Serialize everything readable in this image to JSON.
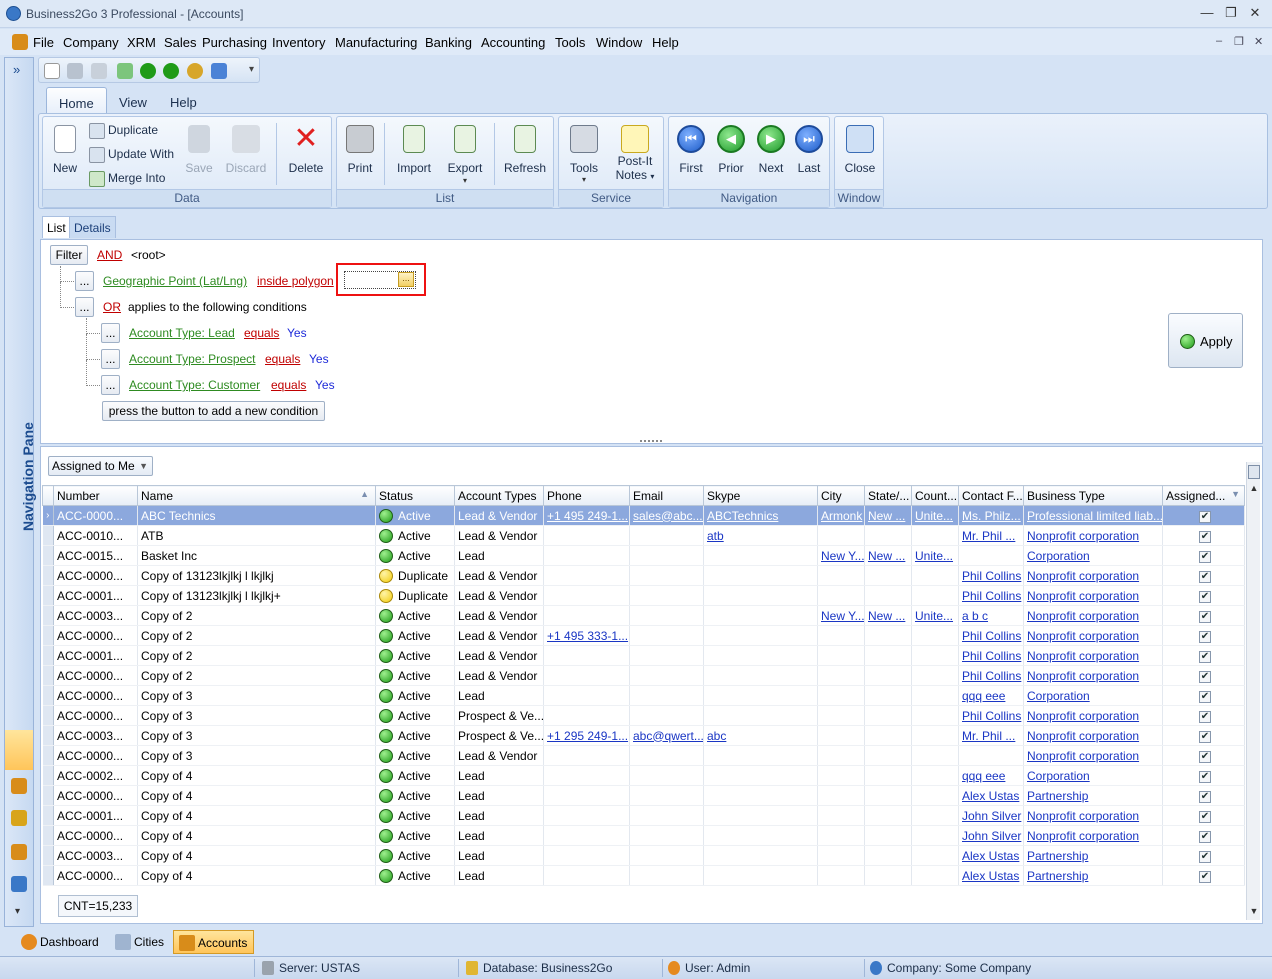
{
  "window": {
    "title": "Business2Go 3 Professional - [Accounts]"
  },
  "menu": [
    "File",
    "Company",
    "XRM",
    "Sales",
    "Purchasing",
    "Inventory",
    "Manufacturing",
    "Banking",
    "Accounting",
    "Tools",
    "Window",
    "Help"
  ],
  "ribbon": {
    "tabs": [
      "Home",
      "View",
      "Help"
    ],
    "groups": {
      "data": "Data",
      "list": "List",
      "service": "Service",
      "navigation": "Navigation",
      "window": "Window"
    },
    "buttons": {
      "new": "New",
      "duplicate": "Duplicate",
      "update_with": "Update With",
      "merge_into": "Merge Into",
      "save": "Save",
      "discard": "Discard",
      "delete": "Delete",
      "print": "Print",
      "import": "Import",
      "export": "Export",
      "refresh": "Refresh",
      "tools": "Tools",
      "postit1": "Post-It",
      "postit2": "Notes",
      "first": "First",
      "prior": "Prior",
      "next": "Next",
      "last": "Last",
      "close": "Close"
    }
  },
  "subtabs": [
    "List",
    "Details"
  ],
  "filter": {
    "filter_btn": "Filter",
    "root_op": "AND",
    "root_label": "<root>",
    "ellipsis": "...",
    "cond1_field": "Geographic Point (Lat/Lng)",
    "cond1_op": "inside polygon",
    "or_op": "OR",
    "or_text": "applies to the following conditions",
    "sub": [
      {
        "field": "Account Type: Lead",
        "op": "equals",
        "val": "Yes"
      },
      {
        "field": "Account Type: Prospect",
        "op": "equals",
        "val": "Yes"
      },
      {
        "field": "Account Type: Customer",
        "op": "equals",
        "val": "Yes"
      }
    ],
    "add_btn": "press the button to add a new condition",
    "apply": "Apply"
  },
  "grid": {
    "dropdown": "Assigned to Me",
    "columns": [
      "Number",
      "Name",
      "Status",
      "Account Types",
      "Phone",
      "Email",
      "Skype",
      "City",
      "State/...",
      "Count...",
      "Contact F...",
      "Business Type",
      "Assigned..."
    ],
    "rows": [
      [
        "ACC-0000...",
        "ABC Technics",
        "Active",
        "Lead & Vendor",
        "+1 495 249-1...",
        "sales@abc....",
        "ABCTechnics",
        "Armonk",
        "New ...",
        "Unite...",
        "Ms. Philz...",
        "Professional limited liab..."
      ],
      [
        "ACC-0010...",
        "ATB",
        "Active",
        "Lead & Vendor",
        "",
        "",
        "atb",
        "",
        "",
        "",
        "Mr. Phil ...",
        "Nonprofit corporation"
      ],
      [
        "ACC-0015...",
        "Basket Inc",
        "Active",
        "Lead",
        "",
        "",
        "",
        "New Y...",
        "New ...",
        "Unite...",
        "",
        "Corporation"
      ],
      [
        "ACC-0000...",
        "Copy of 13123lkjlkj l lkjlkj",
        "Duplicate",
        "Lead & Vendor",
        "",
        "",
        "",
        "",
        "",
        "",
        "Phil Collins",
        "Nonprofit corporation"
      ],
      [
        "ACC-0001...",
        "Copy of 13123lkjlkj l lkjlkj+",
        "Duplicate",
        "Lead & Vendor",
        "",
        "",
        "",
        "",
        "",
        "",
        "Phil Collins",
        "Nonprofit corporation"
      ],
      [
        "ACC-0003...",
        "Copy of 2",
        "Active",
        "Lead & Vendor",
        "",
        "",
        "",
        "New Y...",
        "New ...",
        "Unite...",
        "a b c",
        "Nonprofit corporation"
      ],
      [
        "ACC-0000...",
        "Copy of 2",
        "Active",
        "Lead & Vendor",
        "+1 495 333-1...",
        "",
        "",
        "",
        "",
        "",
        "Phil Collins",
        "Nonprofit corporation"
      ],
      [
        "ACC-0001...",
        "Copy of 2",
        "Active",
        "Lead & Vendor",
        "",
        "",
        "",
        "",
        "",
        "",
        "Phil Collins",
        "Nonprofit corporation"
      ],
      [
        "ACC-0000...",
        "Copy of 2",
        "Active",
        "Lead & Vendor",
        "",
        "",
        "",
        "",
        "",
        "",
        "Phil Collins",
        "Nonprofit corporation"
      ],
      [
        "ACC-0000...",
        "Copy of 3",
        "Active",
        "Lead",
        "",
        "",
        "",
        "",
        "",
        "",
        "qqq eee",
        "Corporation"
      ],
      [
        "ACC-0000...",
        "Copy of 3",
        "Active",
        "Prospect & Ve...",
        "",
        "",
        "",
        "",
        "",
        "",
        "Phil Collins",
        "Nonprofit corporation"
      ],
      [
        "ACC-0003...",
        "Copy of 3",
        "Active",
        "Prospect & Ve...",
        "+1 295 249-1...",
        "abc@qwert...",
        "abc",
        "",
        "",
        "",
        "Mr. Phil ...",
        "Nonprofit corporation"
      ],
      [
        "ACC-0000...",
        "Copy of 3",
        "Active",
        "Lead & Vendor",
        "",
        "",
        "",
        "",
        "",
        "",
        "",
        "Nonprofit corporation"
      ],
      [
        "ACC-0002...",
        "Copy of 4",
        "Active",
        "Lead",
        "",
        "",
        "",
        "",
        "",
        "",
        "qqq eee",
        "Corporation"
      ],
      [
        "ACC-0000...",
        "Copy of 4",
        "Active",
        "Lead",
        "",
        "",
        "",
        "",
        "",
        "",
        "Alex Ustas",
        "Partnership"
      ],
      [
        "ACC-0001...",
        "Copy of 4",
        "Active",
        "Lead",
        "",
        "",
        "",
        "",
        "",
        "",
        "John Silver",
        "Nonprofit corporation"
      ],
      [
        "ACC-0000...",
        "Copy of 4",
        "Active",
        "Lead",
        "",
        "",
        "",
        "",
        "",
        "",
        "John Silver",
        "Nonprofit corporation"
      ],
      [
        "ACC-0003...",
        "Copy of 4",
        "Active",
        "Lead",
        "",
        "",
        "",
        "",
        "",
        "",
        "Alex Ustas",
        "Partnership"
      ],
      [
        "ACC-0000...",
        "Copy of 4",
        "Active",
        "Lead",
        "",
        "",
        "",
        "",
        "",
        "",
        "Alex Ustas",
        "Partnership"
      ]
    ],
    "count": "CNT=15,233"
  },
  "nav": {
    "label": "Navigation Pane",
    "expand": "»"
  },
  "bottom_tabs": [
    "Dashboard",
    "Cities",
    "Accounts"
  ],
  "status": {
    "server": "Server: USTAS",
    "database": "Database: Business2Go",
    "user": "User: Admin",
    "company": "Company: Some Company"
  },
  "colors": {
    "selected_row": "#8ca8dd",
    "filter_field": "#2e8b21",
    "filter_op": "#c00000",
    "filter_value": "#1e2bd9",
    "highlight": "#e11111"
  }
}
